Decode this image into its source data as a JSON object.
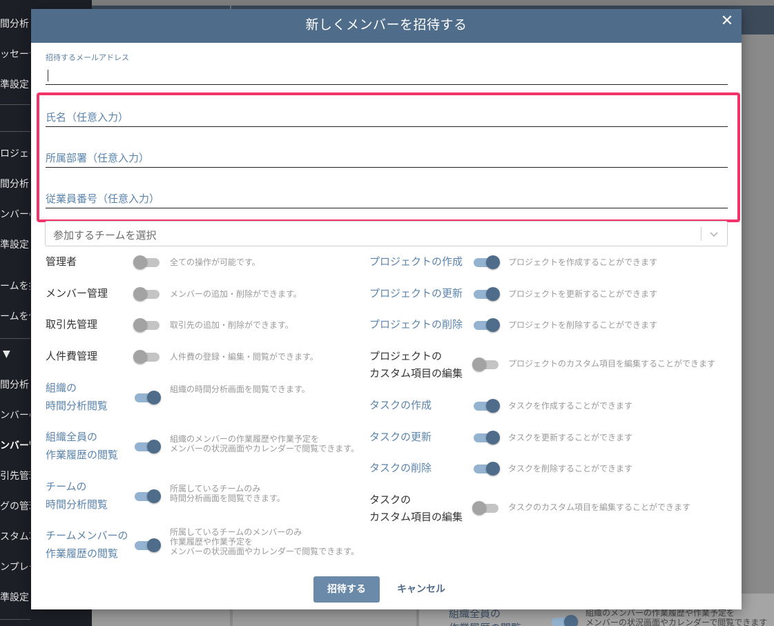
{
  "background": {
    "sidebar_items": [
      {
        "label": "間分析"
      },
      {
        "label": "ッセージ"
      },
      {
        "label": "準設定"
      },
      {
        "label": "ロジェクト"
      },
      {
        "label": "間分析"
      },
      {
        "label": "ンバーの"
      },
      {
        "label": "準設定"
      },
      {
        "label": "ームを探"
      },
      {
        "label": "ームを作"
      },
      {
        "label": "▼"
      },
      {
        "label": "間分析"
      },
      {
        "label": "ンバーの"
      },
      {
        "label": "ンバー管"
      },
      {
        "label": "引先管理"
      },
      {
        "label": "グの管理"
      },
      {
        "label": "スタム項"
      },
      {
        "label": "ンプレー"
      },
      {
        "label": "準設定"
      }
    ],
    "bottom_label_1": "組織全員の",
    "bottom_label_2": "作業履歴の閲覧",
    "bottom_desc_1": "組織のメンバーの作業履歴や作業予定を",
    "bottom_desc_2": "メンバーの状況画面やカレンダーで閲覧できます"
  },
  "modal": {
    "title": "新しくメンバーを招待する",
    "close_icon": "close-icon",
    "email": {
      "label": "招待するメールアドレス",
      "value": ""
    },
    "name_placeholder": "氏名（任意入力）",
    "department_placeholder": "所属部署（任意入力）",
    "employee_number_placeholder": "従業員番号（任意入力）",
    "team_select_placeholder": "参加するチームを選択",
    "highlight_color": "#f5336b",
    "accent_color": "#4f6d8a",
    "left_permissions": [
      {
        "label_1": "管理者",
        "label_2": "",
        "enabled": false,
        "desc_1": "全ての操作が可能です。",
        "desc_2": "",
        "desc_3": ""
      },
      {
        "label_1": "メンバー管理",
        "label_2": "",
        "enabled": false,
        "desc_1": "メンバーの追加・削除ができます。",
        "desc_2": "",
        "desc_3": ""
      },
      {
        "label_1": "取引先管理",
        "label_2": "",
        "enabled": false,
        "desc_1": "取引先の追加・削除ができます。",
        "desc_2": "",
        "desc_3": ""
      },
      {
        "label_1": "人件費管理",
        "label_2": "",
        "enabled": false,
        "desc_1": "人件費の登録・編集・閲覧ができます。",
        "desc_2": "",
        "desc_3": ""
      },
      {
        "label_1": "組織の",
        "label_2": "時間分析閲覧",
        "enabled": true,
        "desc_1": "組織の時間分析画面を閲覧できます。",
        "desc_2": "",
        "desc_3": ""
      },
      {
        "label_1": "組織全員の",
        "label_2": "作業履歴の閲覧",
        "enabled": true,
        "desc_1": "組織のメンバーの作業履歴や作業予定を",
        "desc_2": "メンバーの状況画面やカレンダーで閲覧できます。",
        "desc_3": ""
      },
      {
        "label_1": "チームの",
        "label_2": "時間分析閲覧",
        "enabled": true,
        "desc_1": "所属しているチームのみ",
        "desc_2": "時間分析画面を閲覧できます。",
        "desc_3": ""
      },
      {
        "label_1": "チームメンバーの",
        "label_2": "作業履歴の閲覧",
        "enabled": true,
        "desc_1": "所属しているチームのメンバーのみ",
        "desc_2": "作業履歴や作業予定を",
        "desc_3": "メンバーの状況画面やカレンダーで閲覧できます。"
      }
    ],
    "right_permissions": [
      {
        "label_1": "プロジェクトの作成",
        "label_2": "",
        "enabled": true,
        "desc": "プロジェクトを作成することができます"
      },
      {
        "label_1": "プロジェクトの更新",
        "label_2": "",
        "enabled": true,
        "desc": "プロジェクトを更新することができます"
      },
      {
        "label_1": "プロジェクトの削除",
        "label_2": "",
        "enabled": true,
        "desc": "プロジェクトを削除することができます"
      },
      {
        "label_1": "プロジェクトの",
        "label_2": "カスタム項目の編集",
        "enabled": false,
        "desc": "プロジェクトのカスタム項目を編集することができます"
      },
      {
        "label_1": "タスクの作成",
        "label_2": "",
        "enabled": true,
        "desc": "タスクを作成することができます"
      },
      {
        "label_1": "タスクの更新",
        "label_2": "",
        "enabled": true,
        "desc": "タスクを更新することができます"
      },
      {
        "label_1": "タスクの削除",
        "label_2": "",
        "enabled": true,
        "desc": "タスクを削除することができます"
      },
      {
        "label_1": "タスクの",
        "label_2": "カスタム項目の編集",
        "enabled": false,
        "desc": "タスクのカスタム項目を編集することができます"
      }
    ],
    "invite_label": "招待する",
    "cancel_label": "キャンセル"
  }
}
